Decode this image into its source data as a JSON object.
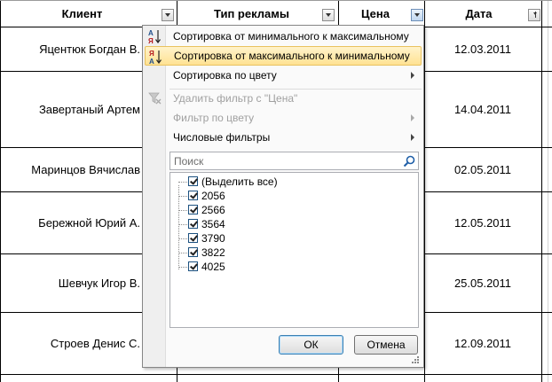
{
  "sheet": {
    "headers": {
      "client": "Клиент",
      "ad_type": "Тип рекламы",
      "price": "Цена",
      "date": "Дата"
    },
    "rows": [
      {
        "client": "Яцентюк Богдан В.",
        "date": "12.03.2011"
      },
      {
        "client": "Завертаный Артем",
        "date": "14.04.2011"
      },
      {
        "client": "Маринцов Вячислав",
        "date": "02.05.2011"
      },
      {
        "client": "Бережной Юрий А.",
        "date": "12.05.2011"
      },
      {
        "client": "Шевчук Игор В.",
        "date": "25.05.2011"
      },
      {
        "client": "Строев Денис С.",
        "date": "12.09.2011"
      }
    ]
  },
  "menu": {
    "sort_asc": "Сортировка от минимального к максимальному",
    "sort_desc": "Сортировка от максимального к минимальному",
    "sort_color": "Сортировка по цвету",
    "clear_filter": "Удалить фильтр с \"Цена\"",
    "filter_color": "Фильтр по цвету",
    "number_filters": "Числовые фильтры",
    "highlighted_item": "sort_desc"
  },
  "search": {
    "placeholder": "Поиск"
  },
  "values": [
    {
      "label": "(Выделить все)",
      "checked": true
    },
    {
      "label": "2056",
      "checked": true
    },
    {
      "label": "2566",
      "checked": true
    },
    {
      "label": "3564",
      "checked": true
    },
    {
      "label": "3790",
      "checked": true
    },
    {
      "label": "3822",
      "checked": true
    },
    {
      "label": "4025",
      "checked": true
    }
  ],
  "buttons": {
    "ok": "ОК",
    "cancel": "Отмена"
  },
  "colors": {
    "highlight": "#ffe293",
    "accent": "#3c7fb1"
  }
}
